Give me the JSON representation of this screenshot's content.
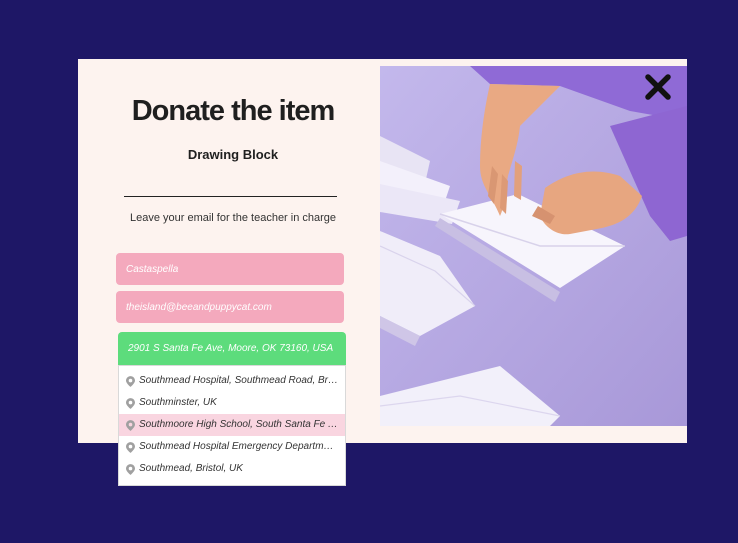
{
  "modal": {
    "title": "Donate the item",
    "item_name": "Drawing Block",
    "helper_text": "Leave your email for the teacher in charge"
  },
  "form": {
    "name_value": "Castaspella",
    "email_value": "theisland@beeandpuppycat.com",
    "address_value": "2901 S Santa Fe Ave, Moore, OK 73160, USA"
  },
  "suggestions": [
    "Southmead Hospital, Southmead Road, Bristol, UK",
    "Southminster, UK",
    "Southmoore High School, South Santa Fe Avenue, Moore, OK, USA",
    "Southmead Hospital Emergency Department, Southmead Road, Bristol, UK",
    "Southmead, Bristol, UK"
  ],
  "suggestion_active_index": 2,
  "icons": {
    "close": "close-icon",
    "location_pin": "location-pin-icon"
  },
  "colors": {
    "page_background": "#1e1766",
    "modal_background": "#fdf3ef",
    "field_pink": "#f4a9bd",
    "field_green": "#5ddc7c",
    "suggestion_highlight": "#f9d5e0"
  }
}
